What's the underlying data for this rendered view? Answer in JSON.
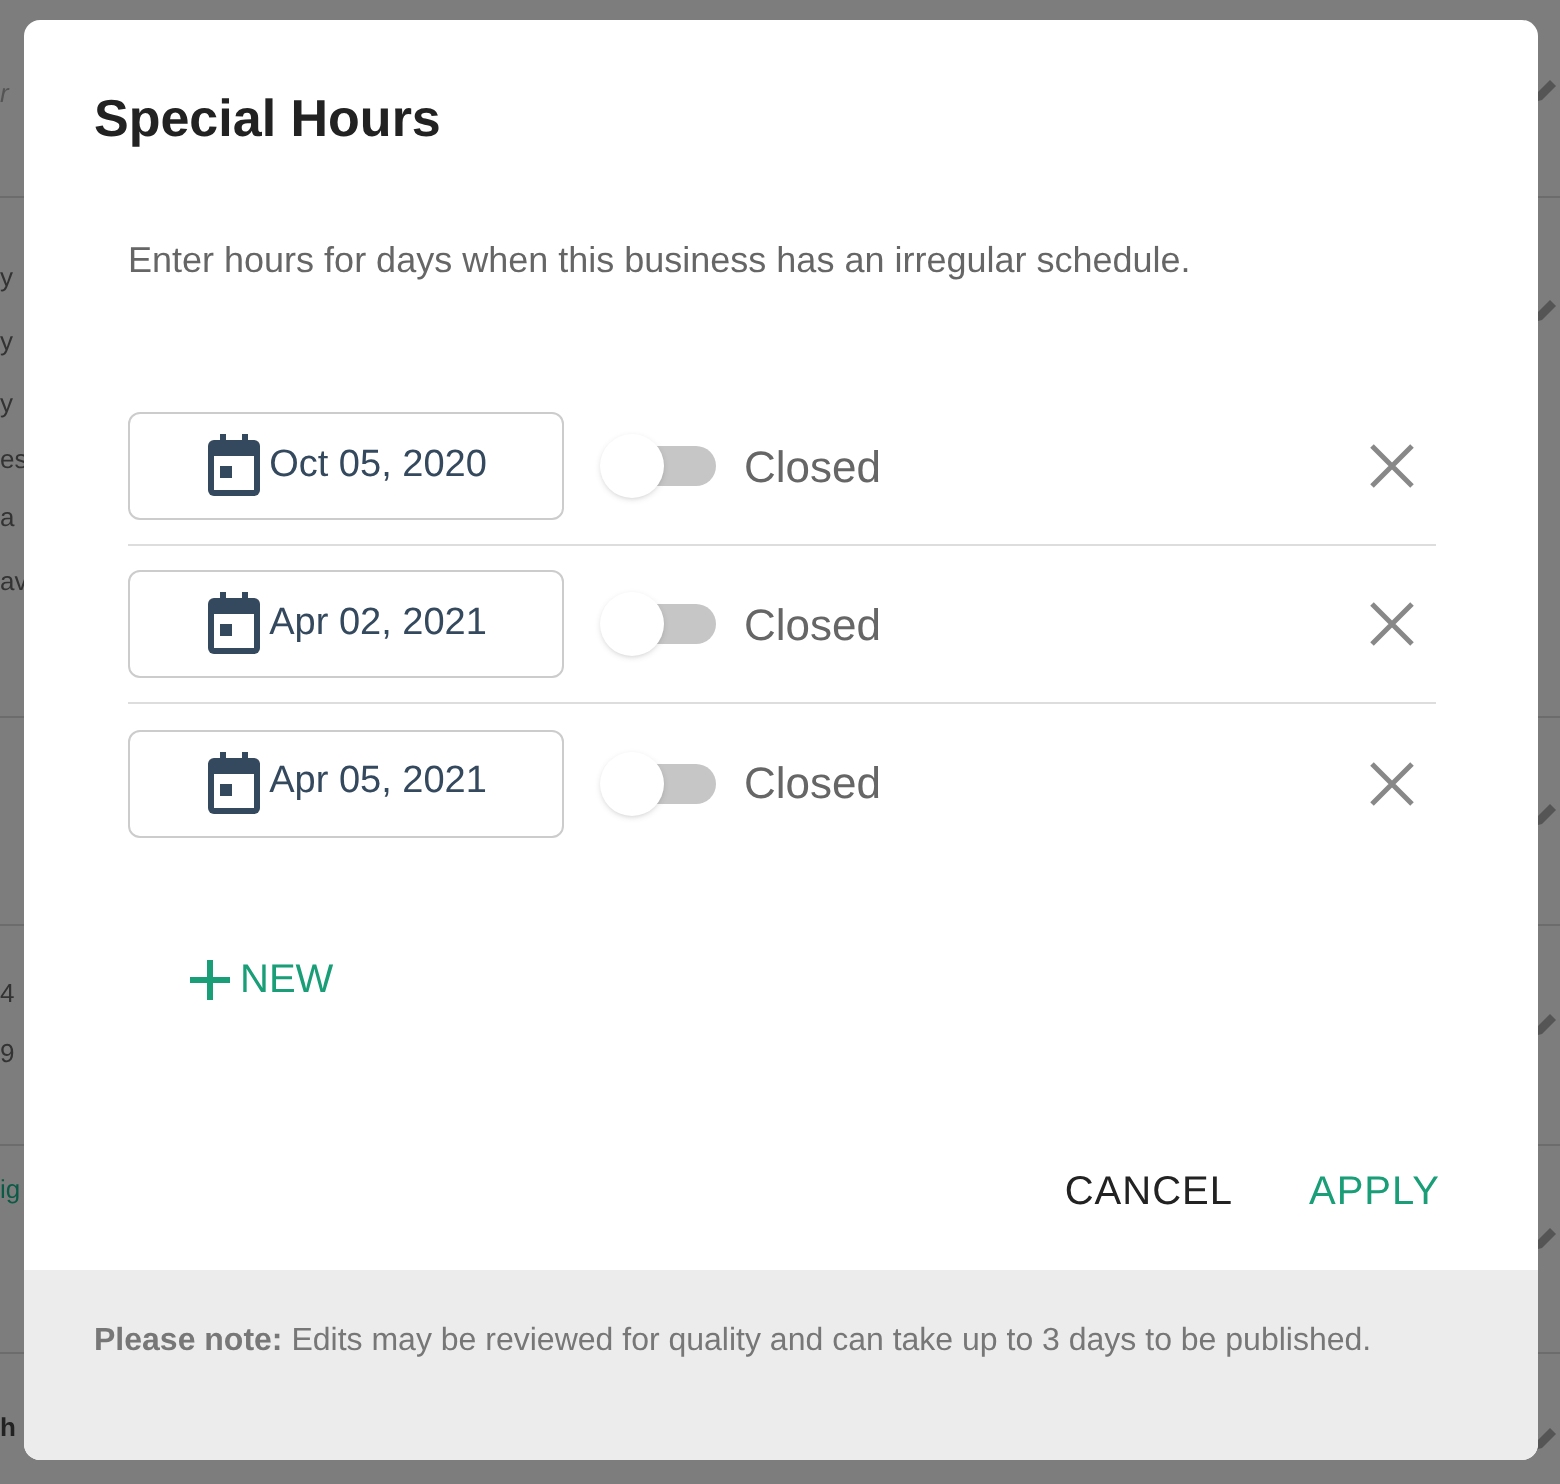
{
  "backdrop": {
    "fragments": [
      {
        "text": "r",
        "kind": "placeholder"
      },
      {
        "text": "y",
        "kind": "text"
      },
      {
        "text": "y",
        "kind": "text"
      },
      {
        "text": "y",
        "kind": "text"
      },
      {
        "text": "es",
        "kind": "text"
      },
      {
        "text": "a",
        "kind": "text"
      },
      {
        "text": "av",
        "kind": "text"
      },
      {
        "text": "4",
        "kind": "text"
      },
      {
        "text": "9",
        "kind": "text"
      },
      {
        "text": "ig",
        "kind": "link"
      },
      {
        "text": "h",
        "kind": "bold"
      }
    ]
  },
  "dialog": {
    "title": "Special Hours",
    "description": "Enter hours for days when this business has an irregular schedule.",
    "rows": [
      {
        "date": "Oct 05, 2020",
        "open": false,
        "status": "Closed"
      },
      {
        "date": "Apr 02, 2021",
        "open": false,
        "status": "Closed"
      },
      {
        "date": "Apr 05, 2021",
        "open": false,
        "status": "Closed"
      }
    ],
    "add_button": "NEW",
    "cancel_button": "CANCEL",
    "apply_button": "APPLY",
    "note": "**Please note:** Edits may be reviewed for quality and can take up to 3 days to be published."
  }
}
